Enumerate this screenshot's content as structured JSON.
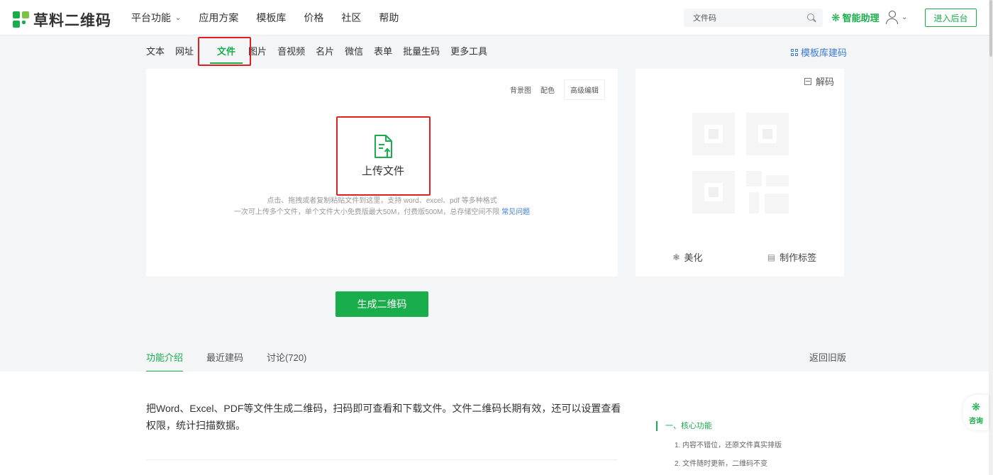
{
  "header": {
    "logo_text": "草料二维码",
    "nav": [
      {
        "label": "平台功能",
        "has_dropdown": true
      },
      {
        "label": "应用方案"
      },
      {
        "label": "模板库"
      },
      {
        "label": "价格"
      },
      {
        "label": "社区"
      },
      {
        "label": "帮助"
      }
    ],
    "search_value": "文件码",
    "ai_assistant": "智能助理",
    "console_button": "进入后台"
  },
  "type_tabs": [
    "文本",
    "网址",
    "文件",
    "图片",
    "音视频",
    "名片",
    "微信",
    "表单",
    "批量生码",
    "更多工具"
  ],
  "active_type_tab": "文件",
  "template_link": "模板库建码",
  "editor": {
    "tools": [
      "背景图",
      "配色",
      "高级编辑"
    ],
    "upload_label": "上传文件",
    "hint_line1": "点击、拖拽或者复制粘贴文件到这里，支持 word、excel、pdf 等多种格式",
    "hint_line2": "一次可上传多个文件，单个文件大小免费版最大50M，付费版500M，总存储空间不限",
    "faq_link": "常见问题"
  },
  "preview": {
    "decode": "解码",
    "beautify": "美化",
    "make_label": "制作标签"
  },
  "generate_button": "生成二维码",
  "lower_tabs": {
    "items": [
      "功能介绍",
      "最近建码",
      "讨论(720)"
    ],
    "active": "功能介绍",
    "back_old": "返回旧版"
  },
  "intro": {
    "description": "把Word、Excel、PDF等文件生成二维码，扫码即可查看和下载文件。文件二维码长期有效，还可以设置查看权限，统计扫描数据。",
    "toc_heading": "一、核心功能",
    "toc_items": [
      "1. 内容不错位，还原文件真实排版",
      "2. 文件随时更新，二维码不变"
    ]
  },
  "consult": "咨询",
  "colors": {
    "brand": "#1aad4c",
    "link": "#3b7ad4",
    "highlight_box": "#e02020"
  }
}
